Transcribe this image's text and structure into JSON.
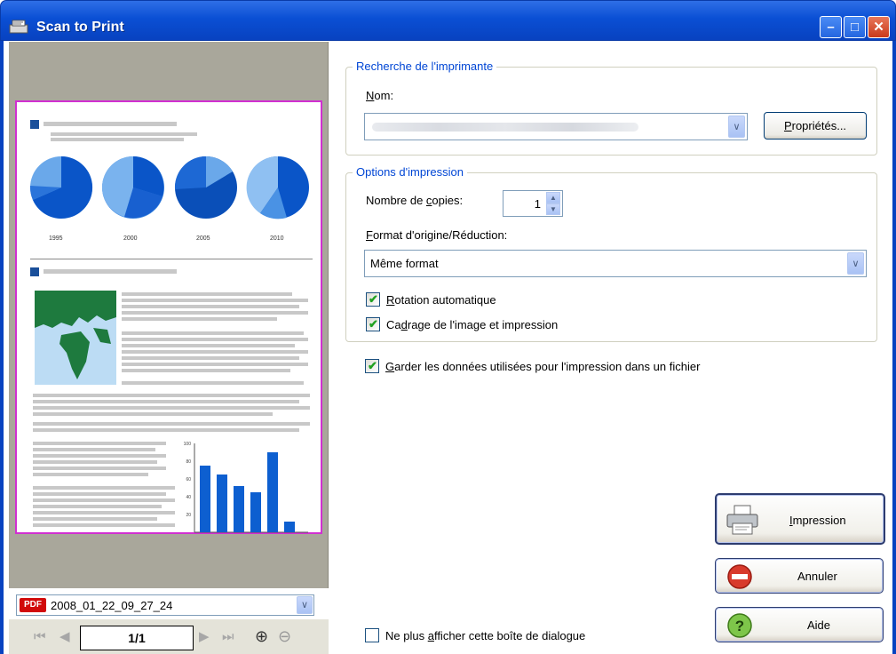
{
  "window": {
    "title": "Scan to Print",
    "min_glyph": "–",
    "max_glyph": "□",
    "close_glyph": "✕"
  },
  "preview": {
    "pie_years": [
      "1995",
      "2000",
      "2005",
      "2010"
    ],
    "bar_axis_ticks": [
      "100",
      "80",
      "60",
      "40",
      "20"
    ],
    "bar_values": [
      75,
      65,
      52,
      45,
      90,
      12
    ]
  },
  "file_select": {
    "icon_text": "PDF",
    "value": "2008_01_22_09_27_24",
    "arrow": "∨"
  },
  "navigation": {
    "first": "⏮",
    "prev": "◀",
    "page": "1/1",
    "next": "▶",
    "last": "⏭",
    "zoom_in": "⊕",
    "zoom_out": "⊖"
  },
  "printer_search": {
    "legend": "Recherche de l'imprimante",
    "name_label_u": "N",
    "name_label_rest": "om:",
    "properties_u": "P",
    "properties_rest": "ropriétés..."
  },
  "print_options": {
    "legend": "Options d'impression",
    "copies_pre": "Nombre de ",
    "copies_u": "c",
    "copies_post": "opies:",
    "copies_value": "1",
    "format_u": "F",
    "format_rest": "ormat d'origine/Réduction:",
    "format_value": "Même format",
    "auto_rotate_u": "R",
    "auto_rotate_rest": "otation automatique",
    "crop_pre": "Ca",
    "crop_u": "d",
    "crop_post": "rage de l'image et impression"
  },
  "keep_data": {
    "u": "G",
    "rest": "arder les données utilisées pour l'impression dans un fichier"
  },
  "dont_show": {
    "pre": "Ne plus ",
    "u": "a",
    "post": "fficher cette boîte de dialogue"
  },
  "buttons": {
    "print_u": "I",
    "print_rest": "mpression",
    "cancel": "Annuler",
    "help": "Aide"
  },
  "colors": {
    "accent": "#0046d5",
    "title_bar": "#0a4fd4",
    "preview_border": "#d12fd1"
  }
}
